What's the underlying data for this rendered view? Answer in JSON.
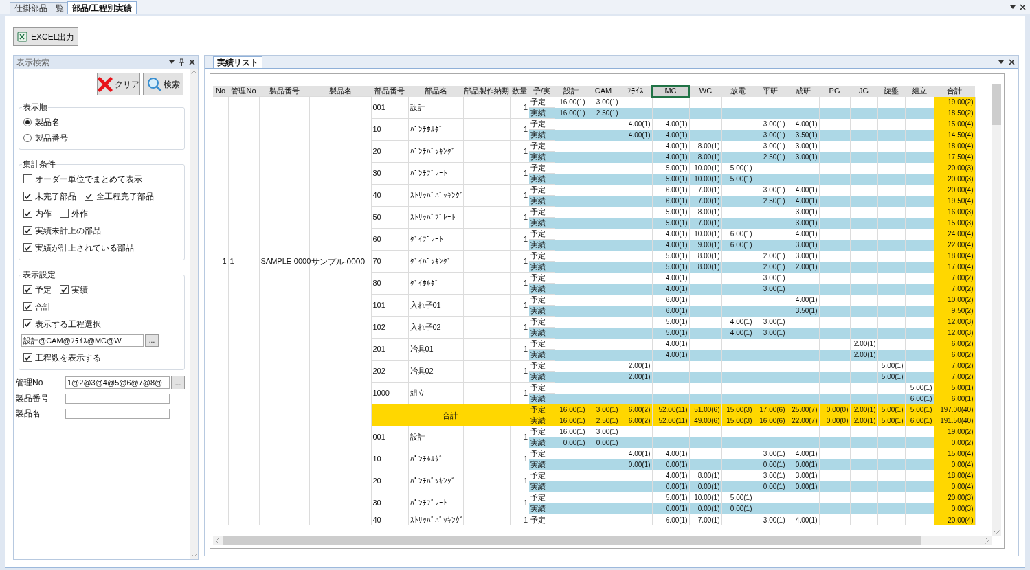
{
  "tabs": [
    {
      "label": "仕掛部品一覧",
      "selected": false
    },
    {
      "label": "部品/工程別実績",
      "selected": true
    }
  ],
  "toolbar": {
    "excel_button": "EXCEL出力"
  },
  "search_panel": {
    "title": "表示検索",
    "clear_button": "クリア",
    "search_button": "検索",
    "sort_group": {
      "title": "表示順",
      "options": [
        {
          "label": "製品名",
          "selected": true
        },
        {
          "label": "製品番号",
          "selected": false
        }
      ]
    },
    "aggregate_group": {
      "title": "集計条件",
      "lines": [
        {
          "checkboxes": [
            {
              "label": "オーダー単位でまとめて表示",
              "checked": false
            }
          ]
        },
        {
          "checkboxes": [
            {
              "label": "未完了部品",
              "checked": true
            },
            {
              "label": "全工程完了部品",
              "checked": true
            }
          ]
        },
        {
          "checkboxes": [
            {
              "label": "内作",
              "checked": true
            },
            {
              "label": "外作",
              "checked": false
            }
          ]
        },
        {
          "checkboxes": [
            {
              "label": "実績未計上の部品",
              "checked": true
            }
          ]
        },
        {
          "checkboxes": [
            {
              "label": "実績が計上されている部品",
              "checked": true
            }
          ]
        }
      ]
    },
    "display_group": {
      "title": "表示設定",
      "lines": [
        {
          "checkboxes": [
            {
              "label": "予定",
              "checked": true
            },
            {
              "label": "実績",
              "checked": true
            }
          ]
        },
        {
          "checkboxes": [
            {
              "label": "合計",
              "checked": true
            }
          ]
        },
        {
          "checkboxes": [
            {
              "label": "表示する工程選択",
              "checked": true
            }
          ]
        }
      ],
      "process_field": "設計@CAM@ﾌﾗｲｽ@MC@W",
      "browse_button": "...",
      "process_count": {
        "label": "工程数を表示する",
        "checked": true
      }
    },
    "fields": [
      {
        "label": "管理No",
        "value": "1@2@3@4@5@6@7@8@",
        "browse_button": "..."
      },
      {
        "label": "製品番号"
      },
      {
        "label": "製品名"
      }
    ]
  },
  "results_panel": {
    "tab": "実績リスト",
    "table": {
      "columns": [
        "No",
        "管理No",
        "製品番号",
        "製品名",
        "部品番号",
        "部品名",
        "部品製作納期",
        "数量",
        "予/実"
      ],
      "process_columns": [
        {
          "label": "設計",
          "selected": false
        },
        {
          "label": "CAM",
          "selected": false
        },
        {
          "label": "ﾌﾗｲｽ",
          "selected": false
        },
        {
          "label": "MC",
          "selected": true
        },
        {
          "label": "WC",
          "selected": false
        },
        {
          "label": "放電",
          "selected": false
        },
        {
          "label": "平研",
          "selected": false
        },
        {
          "label": "成研",
          "selected": false
        },
        {
          "label": "PG",
          "selected": false
        },
        {
          "label": "JG",
          "selected": false
        },
        {
          "label": "旋盤",
          "selected": false
        },
        {
          "label": "組立",
          "selected": false
        },
        {
          "label": "合計",
          "selected": false
        }
      ],
      "groups": [
        {
          "no": "1",
          "control_no": "1",
          "product_no": "SAMPLE-0000",
          "product_name": "サンプル-0000",
          "parts": [
            {
              "part_no": "001",
              "part_name": "設計",
              "qty": "1",
              "plan": {
                "label": "予定",
                "cells": [
                  "16.00(1)",
                  "3.00(1)",
                  null,
                  null,
                  null,
                  null,
                  null,
                  null,
                  null,
                  null,
                  null,
                  null,
                  "19.00(2)"
                ]
              },
              "actual": {
                "label": "実績",
                "cells": [
                  "16.00(1)",
                  "2.50(1)",
                  null,
                  null,
                  null,
                  null,
                  null,
                  null,
                  null,
                  null,
                  null,
                  null,
                  "18.50(2)"
                ]
              }
            },
            {
              "part_no": "10",
              "part_name": "ﾊﾟﾝﾁﾎﾙﾀﾞ",
              "qty": "1",
              "plan": {
                "label": "予定",
                "cells": [
                  null,
                  null,
                  "4.00(1)",
                  "4.00(1)",
                  null,
                  null,
                  "3.00(1)",
                  "4.00(1)",
                  null,
                  null,
                  null,
                  null,
                  "15.00(4)"
                ]
              },
              "actual": {
                "label": "実績",
                "cells": [
                  null,
                  null,
                  "4.00(1)",
                  "4.00(1)",
                  null,
                  null,
                  "3.00(1)",
                  "3.50(1)",
                  null,
                  null,
                  null,
                  null,
                  "14.50(4)"
                ]
              }
            },
            {
              "part_no": "20",
              "part_name": "ﾊﾟﾝﾁﾊﾟｯｷﾝｸﾞ",
              "qty": "1",
              "plan": {
                "label": "予定",
                "cells": [
                  null,
                  null,
                  null,
                  "4.00(1)",
                  "8.00(1)",
                  null,
                  "3.00(1)",
                  "3.00(1)",
                  null,
                  null,
                  null,
                  null,
                  "18.00(4)"
                ]
              },
              "actual": {
                "label": "実績",
                "cells": [
                  null,
                  null,
                  null,
                  "4.00(1)",
                  "8.00(1)",
                  null,
                  "2.50(1)",
                  "3.00(1)",
                  null,
                  null,
                  null,
                  null,
                  "17.50(4)"
                ]
              }
            },
            {
              "part_no": "30",
              "part_name": "ﾊﾟﾝﾁﾌﾟﾚｰﾄ",
              "qty": "1",
              "plan": {
                "label": "予定",
                "cells": [
                  null,
                  null,
                  null,
                  "5.00(1)",
                  "10.00(1)",
                  "5.00(1)",
                  null,
                  null,
                  null,
                  null,
                  null,
                  null,
                  "20.00(3)"
                ]
              },
              "actual": {
                "label": "実績",
                "cells": [
                  null,
                  null,
                  null,
                  "5.00(1)",
                  "10.00(1)",
                  "5.00(1)",
                  null,
                  null,
                  null,
                  null,
                  null,
                  null,
                  "20.00(3)"
                ]
              }
            },
            {
              "part_no": "40",
              "part_name": "ｽﾄﾘｯﾊﾟﾊﾟｯｷﾝｸﾞ",
              "qty": "1",
              "plan": {
                "label": "予定",
                "cells": [
                  null,
                  null,
                  null,
                  "6.00(1)",
                  "7.00(1)",
                  null,
                  "3.00(1)",
                  "4.00(1)",
                  null,
                  null,
                  null,
                  null,
                  "20.00(4)"
                ]
              },
              "actual": {
                "label": "実績",
                "cells": [
                  null,
                  null,
                  null,
                  "6.00(1)",
                  "7.00(1)",
                  null,
                  "2.50(1)",
                  "4.00(1)",
                  null,
                  null,
                  null,
                  null,
                  "19.50(4)"
                ]
              }
            },
            {
              "part_no": "50",
              "part_name": "ｽﾄﾘｯﾊﾟﾌﾟﾚｰﾄ",
              "qty": "1",
              "plan": {
                "label": "予定",
                "cells": [
                  null,
                  null,
                  null,
                  "5.00(1)",
                  "8.00(1)",
                  null,
                  null,
                  "3.00(1)",
                  null,
                  null,
                  null,
                  null,
                  "16.00(3)"
                ]
              },
              "actual": {
                "label": "実績",
                "cells": [
                  null,
                  null,
                  null,
                  "5.00(1)",
                  "7.00(1)",
                  null,
                  null,
                  "3.00(1)",
                  null,
                  null,
                  null,
                  null,
                  "15.00(3)"
                ]
              }
            },
            {
              "part_no": "60",
              "part_name": "ﾀﾞｲﾌﾟﾚｰﾄ",
              "qty": "1",
              "plan": {
                "label": "予定",
                "cells": [
                  null,
                  null,
                  null,
                  "4.00(1)",
                  "10.00(1)",
                  "6.00(1)",
                  null,
                  "4.00(1)",
                  null,
                  null,
                  null,
                  null,
                  "24.00(4)"
                ]
              },
              "actual": {
                "label": "実績",
                "cells": [
                  null,
                  null,
                  null,
                  "4.00(1)",
                  "9.00(1)",
                  "6.00(1)",
                  null,
                  "3.00(1)",
                  null,
                  null,
                  null,
                  null,
                  "22.00(4)"
                ]
              }
            },
            {
              "part_no": "70",
              "part_name": "ﾀﾞｲﾊﾟｯｷﾝｸﾞ",
              "qty": "1",
              "plan": {
                "label": "予定",
                "cells": [
                  null,
                  null,
                  null,
                  "5.00(1)",
                  "8.00(1)",
                  null,
                  "2.00(1)",
                  "3.00(1)",
                  null,
                  null,
                  null,
                  null,
                  "18.00(4)"
                ]
              },
              "actual": {
                "label": "実績",
                "cells": [
                  null,
                  null,
                  null,
                  "5.00(1)",
                  "8.00(1)",
                  null,
                  "2.00(1)",
                  "2.00(1)",
                  null,
                  null,
                  null,
                  null,
                  "17.00(4)"
                ]
              }
            },
            {
              "part_no": "80",
              "part_name": "ﾀﾞｲﾎﾙﾀﾞ",
              "qty": "1",
              "plan": {
                "label": "予定",
                "cells": [
                  null,
                  null,
                  null,
                  "4.00(1)",
                  null,
                  null,
                  "3.00(1)",
                  null,
                  null,
                  null,
                  null,
                  null,
                  "7.00(2)"
                ]
              },
              "actual": {
                "label": "実績",
                "cells": [
                  null,
                  null,
                  null,
                  "4.00(1)",
                  null,
                  null,
                  "3.00(1)",
                  null,
                  null,
                  null,
                  null,
                  null,
                  "7.00(2)"
                ]
              }
            },
            {
              "part_no": "101",
              "part_name": "入れ子01",
              "qty": "1",
              "plan": {
                "label": "予定",
                "cells": [
                  null,
                  null,
                  null,
                  "6.00(1)",
                  null,
                  null,
                  null,
                  "4.00(1)",
                  null,
                  null,
                  null,
                  null,
                  "10.00(2)"
                ]
              },
              "actual": {
                "label": "実績",
                "cells": [
                  null,
                  null,
                  null,
                  "6.00(1)",
                  null,
                  null,
                  null,
                  "3.50(1)",
                  null,
                  null,
                  null,
                  null,
                  "9.50(2)"
                ]
              }
            },
            {
              "part_no": "102",
              "part_name": "入れ子02",
              "qty": "1",
              "plan": {
                "label": "予定",
                "cells": [
                  null,
                  null,
                  null,
                  "5.00(1)",
                  null,
                  "4.00(1)",
                  "3.00(1)",
                  null,
                  null,
                  null,
                  null,
                  null,
                  "12.00(3)"
                ]
              },
              "actual": {
                "label": "実績",
                "cells": [
                  null,
                  null,
                  null,
                  "5.00(1)",
                  null,
                  "4.00(1)",
                  "3.00(1)",
                  null,
                  null,
                  null,
                  null,
                  null,
                  "12.00(3)"
                ]
              }
            },
            {
              "part_no": "201",
              "part_name": "冶具01",
              "qty": "1",
              "plan": {
                "label": "予定",
                "cells": [
                  null,
                  null,
                  null,
                  "4.00(1)",
                  null,
                  null,
                  null,
                  null,
                  null,
                  "2.00(1)",
                  null,
                  null,
                  "6.00(2)"
                ]
              },
              "actual": {
                "label": "実績",
                "cells": [
                  null,
                  null,
                  null,
                  "4.00(1)",
                  null,
                  null,
                  null,
                  null,
                  null,
                  "2.00(1)",
                  null,
                  null,
                  "6.00(2)"
                ]
              }
            },
            {
              "part_no": "202",
              "part_name": "冶具02",
              "qty": "1",
              "plan": {
                "label": "予定",
                "cells": [
                  null,
                  null,
                  "2.00(1)",
                  null,
                  null,
                  null,
                  null,
                  null,
                  null,
                  null,
                  "5.00(1)",
                  null,
                  "7.00(2)"
                ]
              },
              "actual": {
                "label": "実績",
                "cells": [
                  null,
                  null,
                  "2.00(1)",
                  null,
                  null,
                  null,
                  null,
                  null,
                  null,
                  null,
                  "5.00(1)",
                  null,
                  "7.00(2)"
                ]
              }
            },
            {
              "part_no": "1000",
              "part_name": "組立",
              "qty": "1",
              "plan": {
                "label": "予定",
                "cells": [
                  null,
                  null,
                  null,
                  null,
                  null,
                  null,
                  null,
                  null,
                  null,
                  null,
                  null,
                  "5.00(1)",
                  "5.00(1)"
                ]
              },
              "actual": {
                "label": "実績",
                "cells": [
                  null,
                  null,
                  null,
                  null,
                  null,
                  null,
                  null,
                  null,
                  null,
                  null,
                  null,
                  "6.00(1)",
                  "6.00(1)"
                ]
              }
            }
          ],
          "total": {
            "label": "合計",
            "plan": {
              "label": "予定",
              "cells": [
                "16.00(1)",
                "3.00(1)",
                "6.00(2)",
                "52.00(11)",
                "51.00(6)",
                "15.00(3)",
                "17.00(6)",
                "25.00(7)",
                "0.00(0)",
                "2.00(1)",
                "5.00(1)",
                "5.00(1)",
                "197.00(40)"
              ]
            },
            "actual": {
              "label": "実績",
              "cells": [
                "16.00(1)",
                "2.50(1)",
                "6.00(2)",
                "52.00(11)",
                "49.00(6)",
                "15.00(3)",
                "16.00(6)",
                "22.00(7)",
                "0.00(0)",
                "2.00(1)",
                "5.00(1)",
                "6.00(1)",
                "191.50(40)"
              ]
            }
          }
        },
        {
          "parts": [
            {
              "part_no": "001",
              "part_name": "設計",
              "qty": "1",
              "plan": {
                "label": "予定",
                "cells": [
                  "16.00(1)",
                  "3.00(1)",
                  null,
                  null,
                  null,
                  null,
                  null,
                  null,
                  null,
                  null,
                  null,
                  null,
                  "19.00(2)"
                ]
              },
              "actual": {
                "label": "実績",
                "cells": [
                  "0.00(1)",
                  "0.00(1)",
                  null,
                  null,
                  null,
                  null,
                  null,
                  null,
                  null,
                  null,
                  null,
                  null,
                  "0.00(2)"
                ]
              }
            },
            {
              "part_no": "10",
              "part_name": "ﾊﾟﾝﾁﾎﾙﾀﾞ",
              "qty": "1",
              "plan": {
                "label": "予定",
                "cells": [
                  null,
                  null,
                  "4.00(1)",
                  "4.00(1)",
                  null,
                  null,
                  "3.00(1)",
                  "4.00(1)",
                  null,
                  null,
                  null,
                  null,
                  "15.00(4)"
                ]
              },
              "actual": {
                "label": "実績",
                "cells": [
                  null,
                  null,
                  "0.00(1)",
                  "0.00(1)",
                  null,
                  null,
                  "0.00(1)",
                  "0.00(1)",
                  null,
                  null,
                  null,
                  null,
                  "0.00(4)"
                ]
              }
            },
            {
              "part_no": "20",
              "part_name": "ﾊﾟﾝﾁﾊﾟｯｷﾝｸﾞ",
              "qty": "1",
              "plan": {
                "label": "予定",
                "cells": [
                  null,
                  null,
                  null,
                  "4.00(1)",
                  "8.00(1)",
                  null,
                  "3.00(1)",
                  "3.00(1)",
                  null,
                  null,
                  null,
                  null,
                  "18.00(4)"
                ]
              },
              "actual": {
                "label": "実績",
                "cells": [
                  null,
                  null,
                  null,
                  "0.00(1)",
                  "0.00(1)",
                  null,
                  "0.00(1)",
                  "0.00(1)",
                  null,
                  null,
                  null,
                  null,
                  "0.00(4)"
                ]
              }
            },
            {
              "part_no": "30",
              "part_name": "ﾊﾟﾝﾁﾌﾟﾚｰﾄ",
              "qty": "1",
              "plan": {
                "label": "予定",
                "cells": [
                  null,
                  null,
                  null,
                  "5.00(1)",
                  "10.00(1)",
                  "5.00(1)",
                  null,
                  null,
                  null,
                  null,
                  null,
                  null,
                  "20.00(3)"
                ]
              },
              "actual": {
                "label": "実績",
                "cells": [
                  null,
                  null,
                  null,
                  "0.00(1)",
                  "0.00(1)",
                  "0.00(1)",
                  null,
                  null,
                  null,
                  null,
                  null,
                  null,
                  "0.00(3)"
                ]
              }
            },
            {
              "part_no": "40",
              "part_name": "ｽﾄﾘｯﾊﾟﾊﾟｯｷﾝｸﾞ",
              "qty": "1",
              "plan": {
                "label": "予定",
                "cells": [
                  null,
                  null,
                  null,
                  "6.00(1)",
                  "7.00(1)",
                  null,
                  "3.00(1)",
                  "4.00(1)",
                  null,
                  null,
                  null,
                  null,
                  "20.00(4)"
                ]
              }
            }
          ]
        }
      ]
    }
  }
}
